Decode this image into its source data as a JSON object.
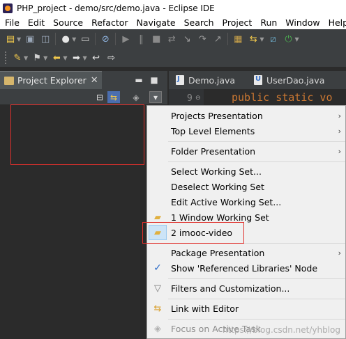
{
  "window": {
    "title": "PHP_project - demo/src/demo.java - Eclipse IDE"
  },
  "menubar": {
    "items": [
      "File",
      "Edit",
      "Source",
      "Refactor",
      "Navigate",
      "Search",
      "Project",
      "Run",
      "Window",
      "Help"
    ]
  },
  "toolbar": {
    "row1_icons": [
      "new-icon",
      "save-icon",
      "save-all-icon",
      "debug-icon",
      "terminal-icon",
      "skip-breakpoints-icon",
      "resume-icon",
      "suspend-icon",
      "terminate-icon",
      "disconnect-icon",
      "step-into-icon",
      "step-over-icon",
      "step-return-icon",
      "open-task-icon",
      "perspective-icon",
      "java-perspective-icon",
      "run-icon"
    ],
    "row2_icons": [
      "annotation-next-icon",
      "pin-icon",
      "back-icon",
      "forward-icon",
      "last-edit-icon",
      "nav-icon"
    ]
  },
  "explorer": {
    "tab_label": "Project Explorer",
    "close_glyph": "✕"
  },
  "editor": {
    "tabs": [
      "Demo.java",
      "UserDao.java"
    ],
    "line_number": "9",
    "code": "public static vo"
  },
  "context_menu": {
    "items": [
      {
        "label": "Projects Presentation",
        "submenu": true
      },
      {
        "label": "Top Level Elements",
        "submenu": true
      },
      {
        "label": "Folder Presentation",
        "submenu": true
      },
      {
        "label": "Select Working Set..."
      },
      {
        "label": "Deselect Working Set"
      },
      {
        "label": "Edit Active Working Set..."
      },
      {
        "label": "1 Window Working Set"
      },
      {
        "label": "2 imooc-video"
      },
      {
        "label": "Package Presentation",
        "submenu": true
      },
      {
        "label": "Show 'Referenced Libraries' Node",
        "checked": true
      },
      {
        "label": "Filters and Customization..."
      },
      {
        "label": "Link with Editor"
      },
      {
        "label": "Focus on Active Task",
        "disabled": true
      }
    ]
  },
  "watermark": "https://blog.csdn.net/yhblog",
  "colors": {
    "highlight_box": "#e0302c",
    "dark_bg": "#2b2b2b",
    "toolbar_bg": "#3c3f41",
    "menu_bg": "#f0f0f0",
    "keyword": "#cc7832"
  }
}
